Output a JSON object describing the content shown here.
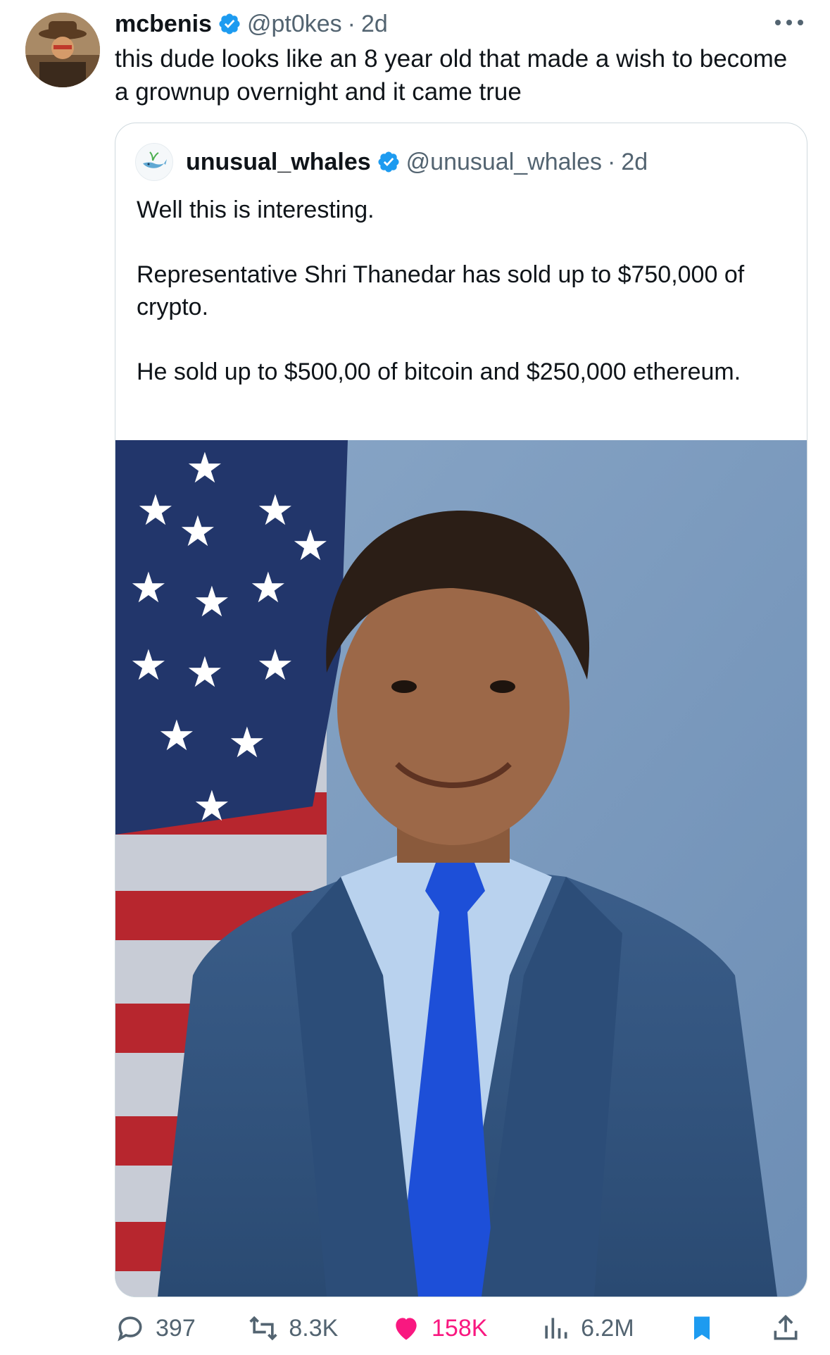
{
  "tweet": {
    "author_name": "mcbenis",
    "handle": "@pt0kes",
    "separator": "·",
    "time": "2d",
    "text": "this dude looks like an 8 year old that made a wish to become a grownup overnight and it came true"
  },
  "quoted": {
    "author_name": "unusual_whales",
    "handle": "@unusual_whales",
    "separator": "·",
    "time": "2d",
    "paragraphs": [
      "Well this is interesting.",
      "Representative Shri Thanedar has sold up to $750,000 of crypto.",
      "He sold up to $500,00 of bitcoin and $250,000 ethereum."
    ]
  },
  "actions": {
    "replies": "397",
    "reposts": "8.3K",
    "likes": "158K",
    "views": "6.2M"
  },
  "colors": {
    "verified": "#1d9bf0",
    "like": "#f91880",
    "bookmark": "#1d9bf0",
    "secondary_text": "#536471"
  },
  "icons": [
    "verified-badge-icon",
    "more-icon",
    "reply-icon",
    "repost-icon",
    "heart-icon",
    "views-icon",
    "bookmark-icon",
    "share-icon"
  ]
}
